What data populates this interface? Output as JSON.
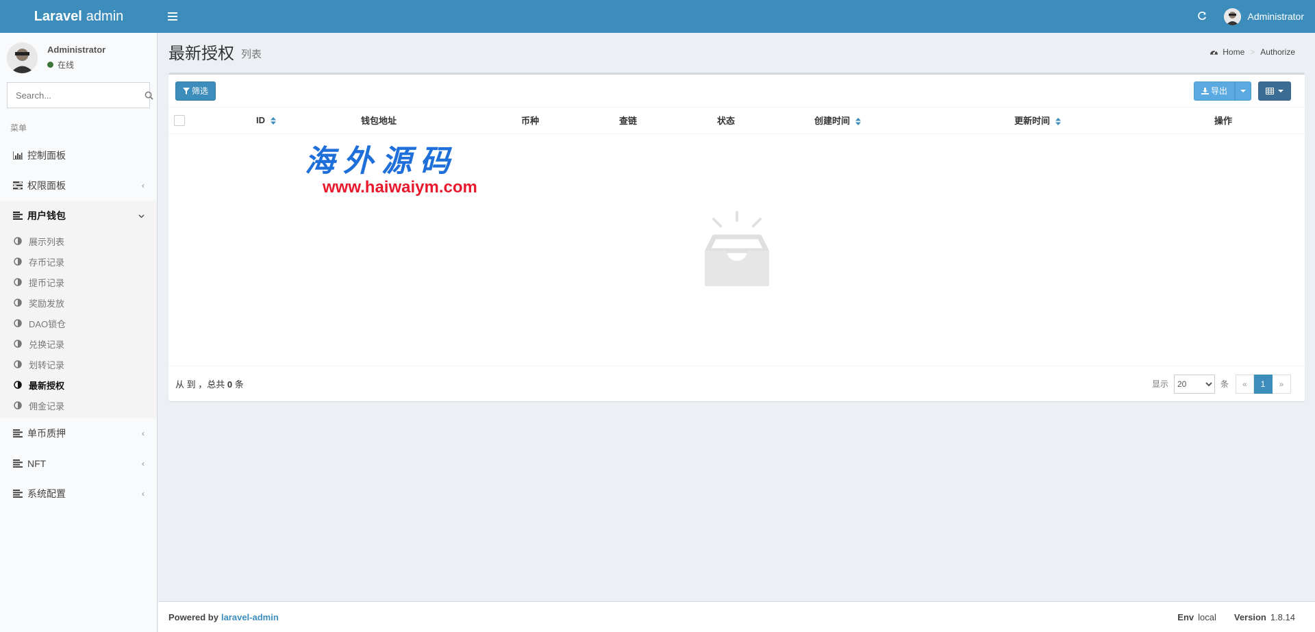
{
  "topbar": {
    "logo_bold": "Laravel",
    "logo_light": "admin",
    "user_name": "Administrator"
  },
  "sidebar": {
    "user_name": "Administrator",
    "user_status": "在线",
    "search_placeholder": "Search...",
    "menu_header": "菜单",
    "items": [
      {
        "label": "控制面板",
        "icon": "bar-chart-icon"
      },
      {
        "label": "权限面板",
        "icon": "tasks-icon"
      },
      {
        "label": "用户钱包",
        "icon": "bars-icon"
      },
      {
        "label": "单币质押",
        "icon": "bars-icon"
      },
      {
        "label": "NFT",
        "icon": "bars-icon"
      },
      {
        "label": "系统配置",
        "icon": "bars-icon"
      }
    ],
    "subitems": [
      "展示列表",
      "存币记录",
      "提币记录",
      "奖励发放",
      "DAO锁仓",
      "兑换记录",
      "划转记录",
      "最新授权",
      "佣金记录"
    ]
  },
  "content": {
    "title": "最新授权",
    "subtitle": "列表",
    "breadcrumb_home": "Home",
    "breadcrumb_current": "Authorize"
  },
  "toolbar": {
    "filter_label": "筛选",
    "export_label": "导出"
  },
  "table": {
    "columns": [
      "ID",
      "钱包地址",
      "币种",
      "查链",
      "状态",
      "创建时间",
      "更新时间",
      "操作"
    ]
  },
  "watermark": {
    "title": "海外源码",
    "url": "www.haiwaiym.com"
  },
  "footer": {
    "summary_prefix": "从 到 ，总共",
    "total": "0",
    "summary_suffix": "条",
    "show_label": "显示",
    "per_page": "20",
    "per_page_suffix": "条",
    "prev": "«",
    "current_page": "1",
    "next": "»"
  },
  "main_footer": {
    "powered_by": "Powered by",
    "link": "laravel-admin",
    "env_label": "Env",
    "env_value": "local",
    "version_label": "Version",
    "version_value": "1.8.14"
  },
  "colors": {
    "primary": "#3c8dbc",
    "sidebar_bg": "#f9fafc",
    "content_bg": "#ecf0f5",
    "online": "#3c763d"
  }
}
